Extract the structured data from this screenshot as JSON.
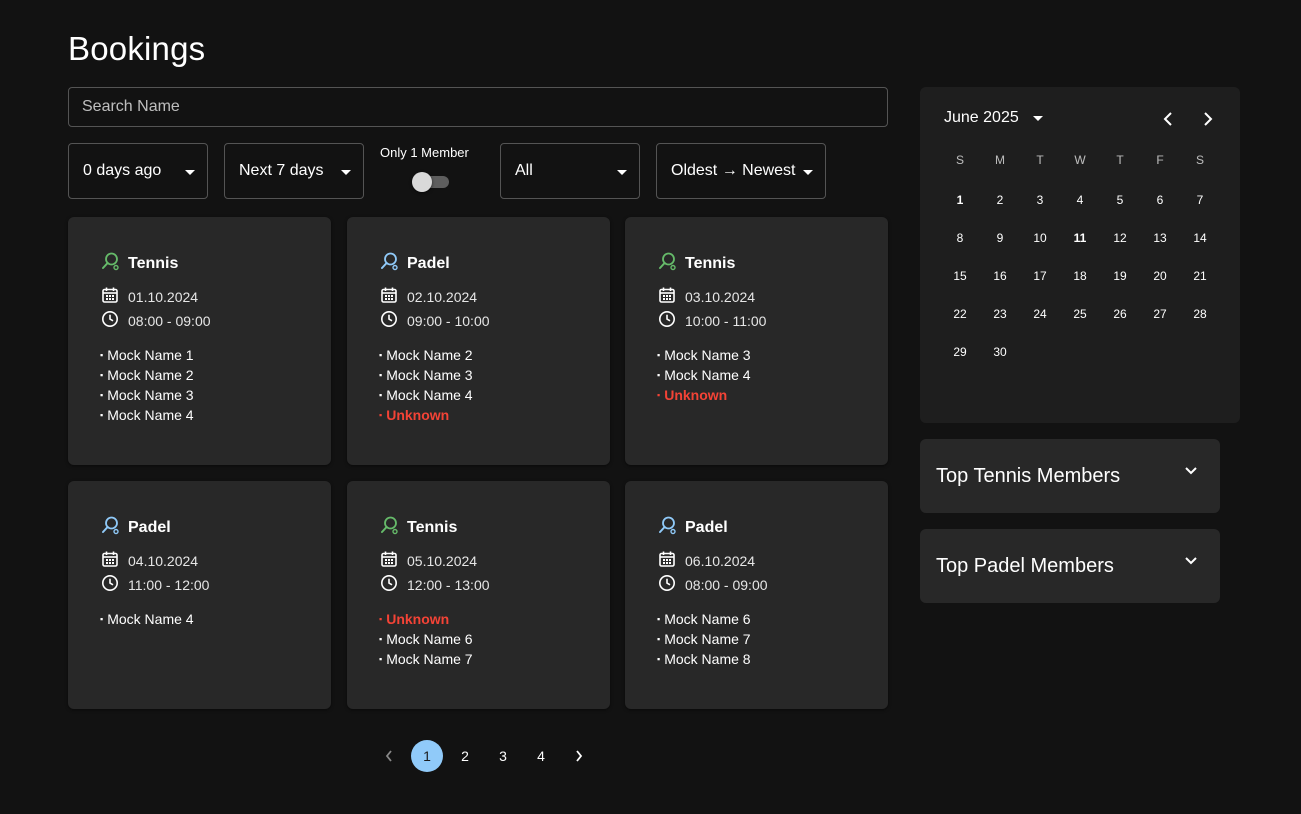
{
  "page": {
    "title": "Bookings"
  },
  "search": {
    "placeholder": "Search Name",
    "value": ""
  },
  "filters": {
    "from": "0 days ago",
    "to": "Next 7 days",
    "toggle_label": "Only 1 Member",
    "toggle_on": false,
    "type": "All",
    "sort": "Oldest → Newest"
  },
  "colors": {
    "tennis": "#66bb6a",
    "padel": "#90caf9",
    "unknown": "#f44336",
    "accent": "#90caf9"
  },
  "bookings": [
    {
      "sport": "Tennis",
      "icon": "tennis-racket-icon",
      "date": "01.10.2024",
      "time": "08:00 - 09:00",
      "members": [
        {
          "name": "Mock Name 1"
        },
        {
          "name": "Mock Name 2"
        },
        {
          "name": "Mock Name 3"
        },
        {
          "name": "Mock Name 4"
        }
      ]
    },
    {
      "sport": "Padel",
      "icon": "padel-racket-icon",
      "date": "02.10.2024",
      "time": "09:00 - 10:00",
      "members": [
        {
          "name": "Mock Name 2"
        },
        {
          "name": "Mock Name 3"
        },
        {
          "name": "Mock Name 4"
        },
        {
          "name": "Unknown",
          "unknown": true
        }
      ]
    },
    {
      "sport": "Tennis",
      "icon": "tennis-racket-icon",
      "date": "03.10.2024",
      "time": "10:00 - 11:00",
      "members": [
        {
          "name": "Mock Name 3"
        },
        {
          "name": "Mock Name 4"
        },
        {
          "name": "Unknown",
          "unknown": true
        }
      ]
    },
    {
      "sport": "Padel",
      "icon": "padel-racket-icon",
      "date": "04.10.2024",
      "time": "11:00 - 12:00",
      "members": [
        {
          "name": "Mock Name 4"
        }
      ]
    },
    {
      "sport": "Tennis",
      "icon": "tennis-racket-icon",
      "date": "05.10.2024",
      "time": "12:00 - 13:00",
      "members": [
        {
          "name": "Unknown",
          "unknown": true
        },
        {
          "name": "Mock Name 6"
        },
        {
          "name": "Mock Name 7"
        }
      ]
    },
    {
      "sport": "Padel",
      "icon": "padel-racket-icon",
      "date": "06.10.2024",
      "time": "08:00 - 09:00",
      "members": [
        {
          "name": "Mock Name 6"
        },
        {
          "name": "Mock Name 7"
        },
        {
          "name": "Mock Name 8"
        }
      ]
    }
  ],
  "calendar": {
    "month_label": "June 2025",
    "weekdays": [
      "S",
      "M",
      "T",
      "W",
      "T",
      "F",
      "S"
    ],
    "weeks": [
      [
        "1",
        "2",
        "3",
        "4",
        "5",
        "6",
        "7"
      ],
      [
        "8",
        "9",
        "10",
        "11",
        "12",
        "13",
        "14"
      ],
      [
        "15",
        "16",
        "17",
        "18",
        "19",
        "20",
        "21"
      ],
      [
        "22",
        "23",
        "24",
        "25",
        "26",
        "27",
        "28"
      ],
      [
        "29",
        "30",
        "",
        "",
        "",
        "",
        ""
      ]
    ],
    "highlighted": [
      "1",
      "11"
    ]
  },
  "accordions": [
    {
      "title": "Top Tennis Members"
    },
    {
      "title": "Top Padel Members"
    }
  ],
  "pagination": {
    "pages": [
      "1",
      "2",
      "3",
      "4"
    ],
    "current": "1"
  }
}
